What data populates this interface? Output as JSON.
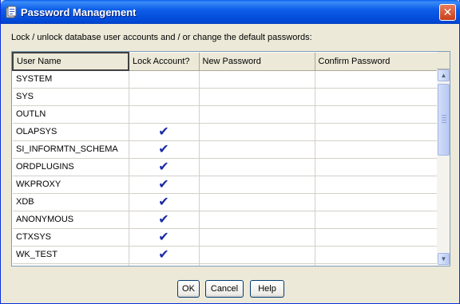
{
  "window": {
    "title": "Password Management",
    "close_glyph": "✕"
  },
  "instruction": "Lock / unlock database user accounts and / or change the default passwords:",
  "columns": [
    "User Name",
    "Lock Account?",
    "New Password",
    "Confirm Password"
  ],
  "rows": [
    {
      "user": "SYSTEM",
      "locked": ""
    },
    {
      "user": "SYS",
      "locked": ""
    },
    {
      "user": "OUTLN",
      "locked": ""
    },
    {
      "user": "OLAPSYS",
      "locked": "✔"
    },
    {
      "user": "SI_INFORMTN_SCHEMA",
      "locked": "✔"
    },
    {
      "user": "ORDPLUGINS",
      "locked": "✔"
    },
    {
      "user": "WKPROXY",
      "locked": "✔"
    },
    {
      "user": "XDB",
      "locked": "✔"
    },
    {
      "user": "ANONYMOUS",
      "locked": "✔"
    },
    {
      "user": "CTXSYS",
      "locked": "✔"
    },
    {
      "user": "WK_TEST",
      "locked": "✔"
    }
  ],
  "scrollbar": {
    "up_glyph": "▲",
    "down_glyph": "▼"
  },
  "buttons": {
    "ok": "OK",
    "cancel": "Cancel",
    "help": "Help"
  }
}
